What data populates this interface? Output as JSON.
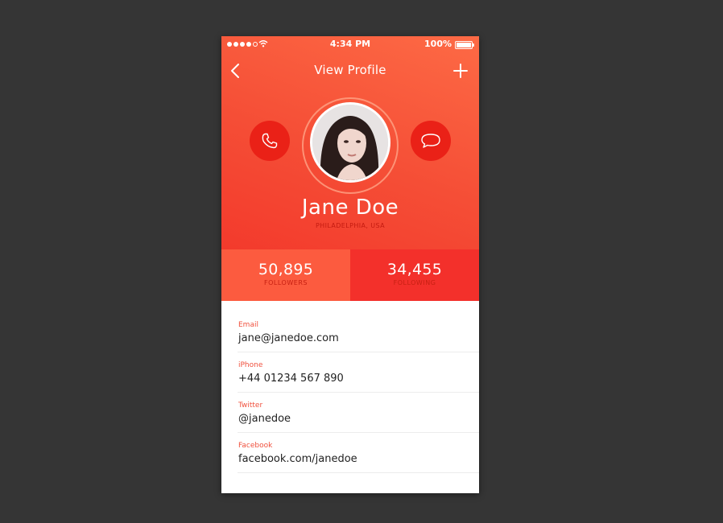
{
  "status_bar": {
    "time": "4:34 PM",
    "battery": "100%"
  },
  "nav": {
    "title": "View Profile",
    "back_icon": "chevron-left-icon",
    "add_icon": "plus-icon"
  },
  "profile": {
    "name": "Jane Doe",
    "location": "PHILADELPHIA, USA",
    "call_icon": "phone-icon",
    "message_icon": "chat-bubble-icon"
  },
  "stats": {
    "followers_value": "50,895",
    "followers_label": "FOLLOWERS",
    "following_value": "34,455",
    "following_label": "FOLLOWING"
  },
  "contacts": [
    {
      "label": "Email",
      "value": "jane@janedoe.com"
    },
    {
      "label": "iPhone",
      "value": "+44 01234 567 890"
    },
    {
      "label": "Twitter",
      "value": "@janedoe"
    },
    {
      "label": "Facebook",
      "value": "facebook.com/janedoe"
    }
  ],
  "colors": {
    "accent": "#f54e36",
    "accent_dark": "#ea2117",
    "label": "#f0503d"
  }
}
